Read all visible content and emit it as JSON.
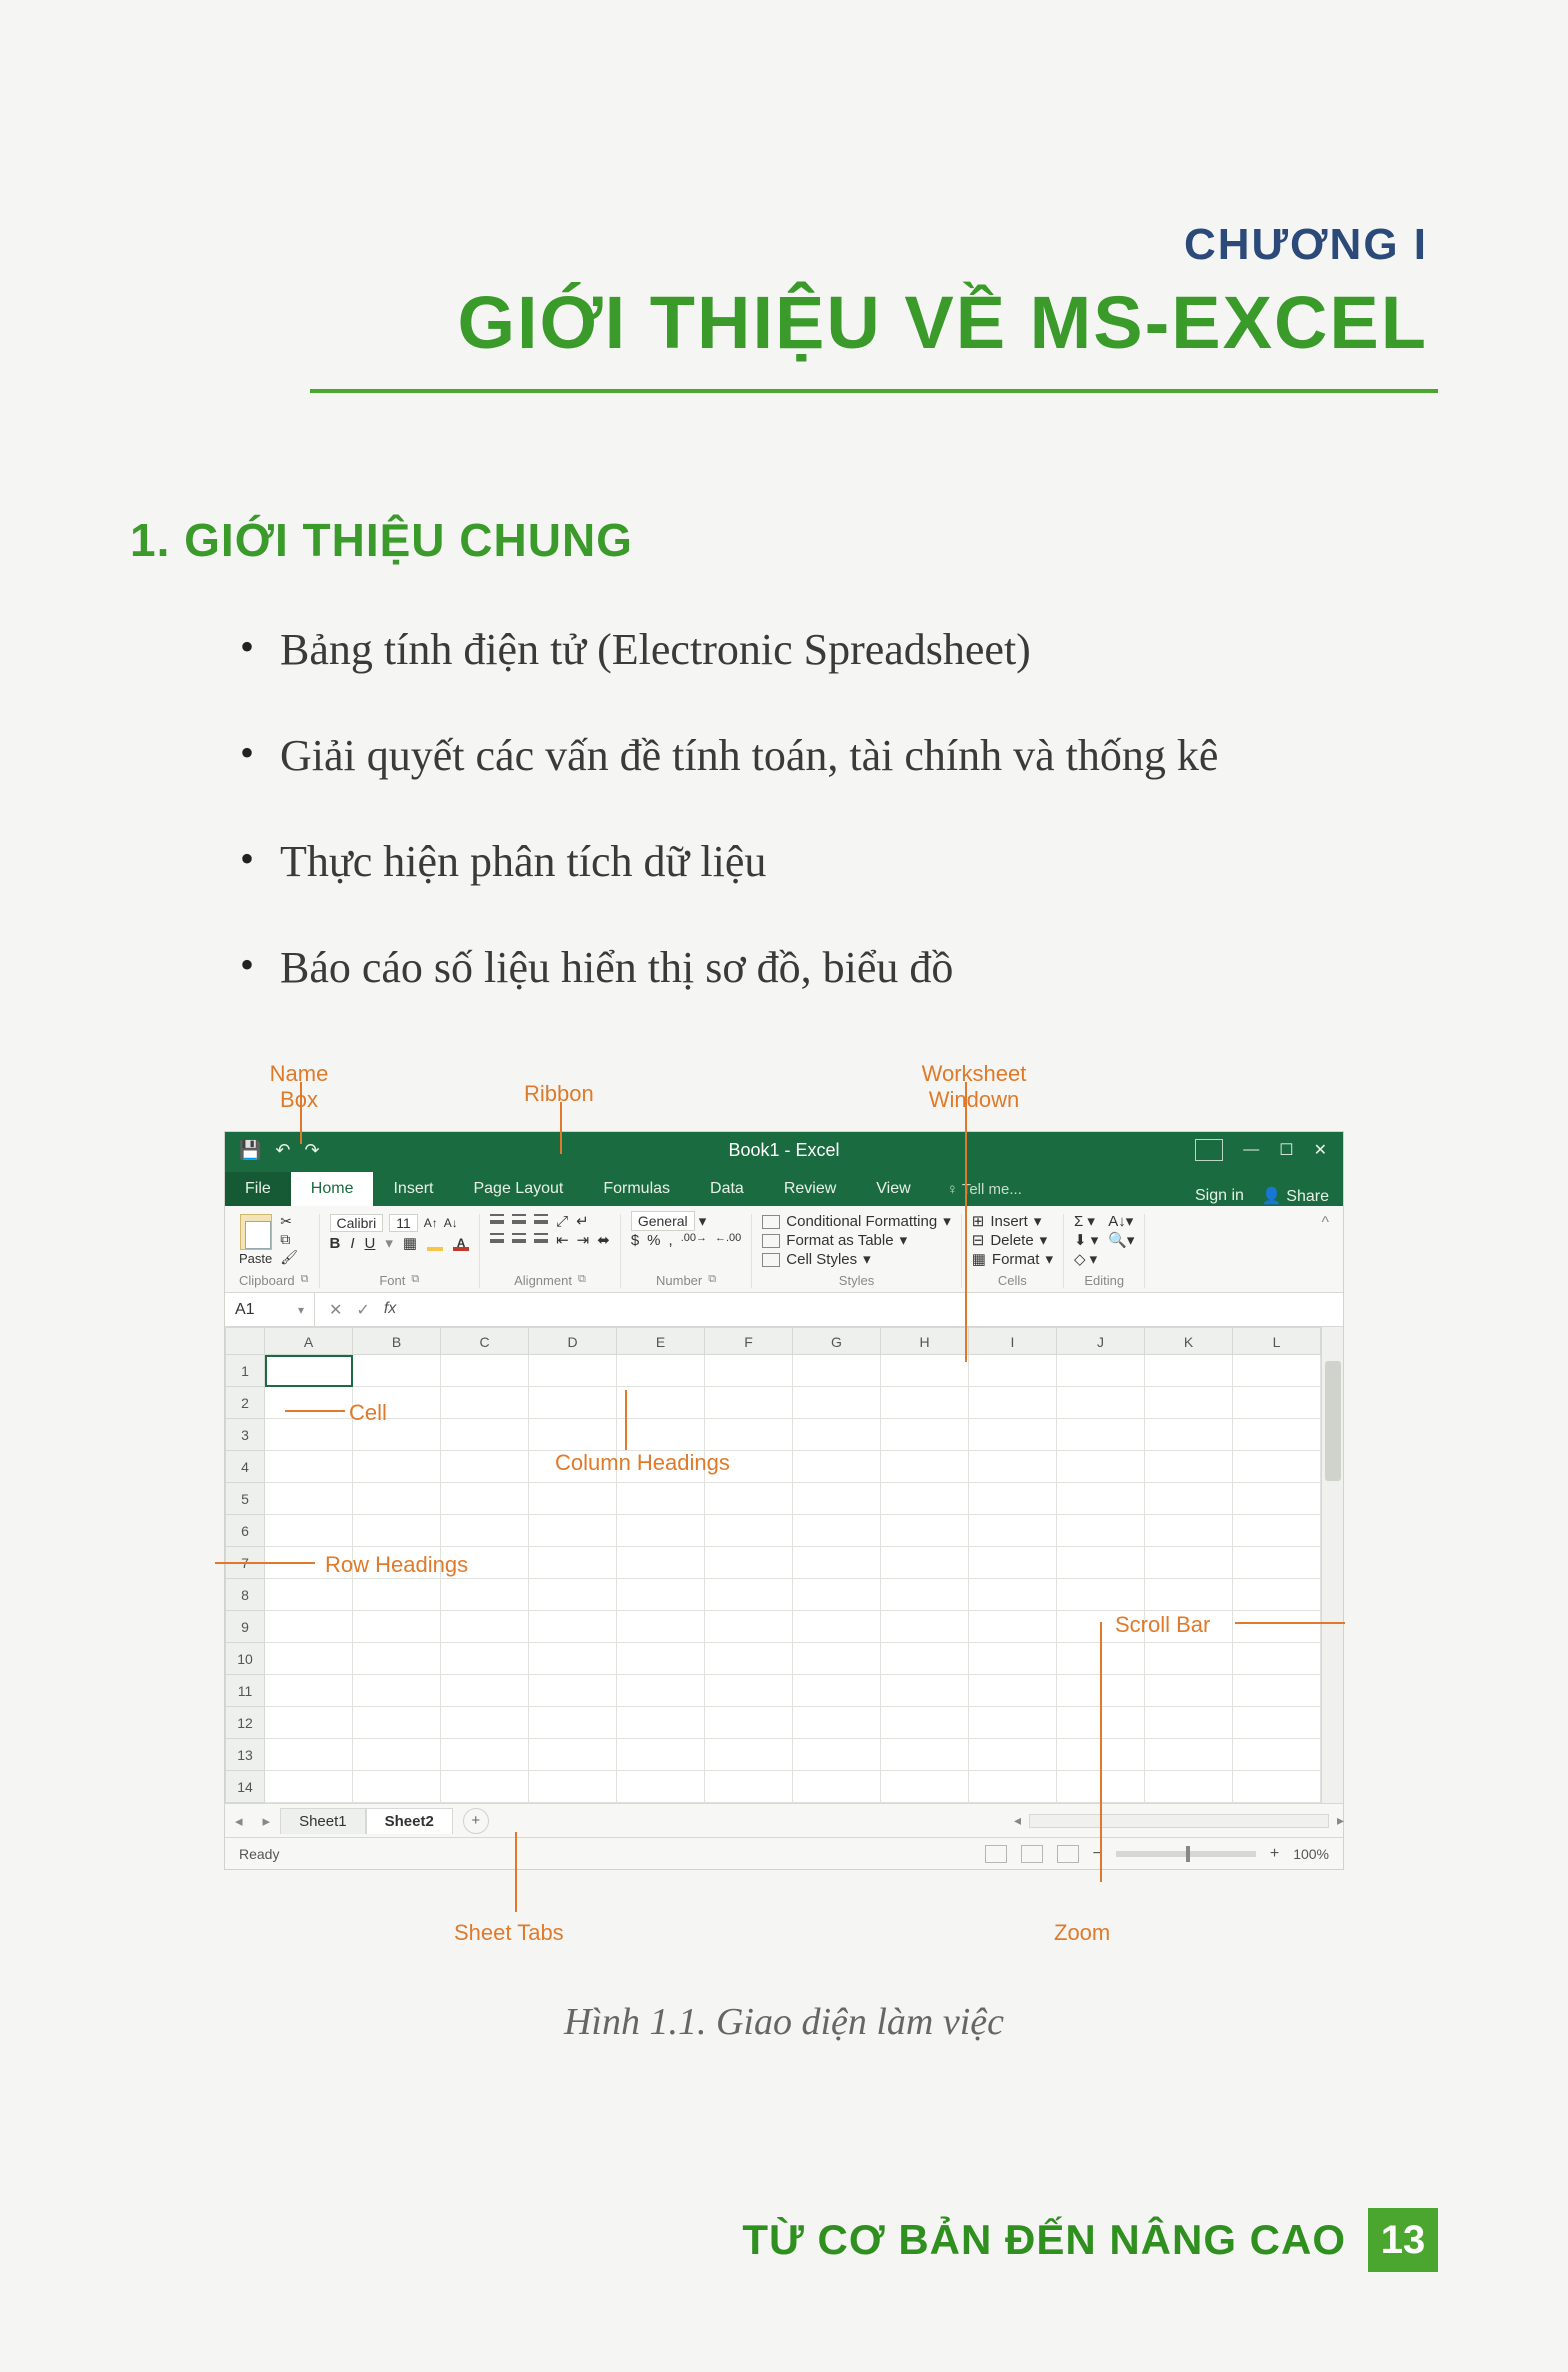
{
  "chapter_label": "CHƯƠNG I",
  "chapter_title": "GIỚI THIỆU VỀ MS-EXCEL",
  "section1_title": "1. GIỚI THIỆU CHUNG",
  "bullets": [
    "Bảng tính điện tử (Electronic Spreadsheet)",
    "Giải quyết các vấn đề tính toán, tài chính và thống kê",
    "Thực hiện phân tích dữ liệu",
    "Báo cáo số liệu hiển thị sơ đồ, biểu đồ"
  ],
  "callouts": {
    "name_box": "Name\nBox",
    "ribbon": "Ribbon",
    "worksheet_window": "Worksheet\nWindown",
    "cell": "Cell",
    "column_headings": "Column Headings",
    "row_headings": "Row Headings",
    "scroll_bar": "Scroll Bar",
    "sheet_tabs": "Sheet Tabs",
    "zoom": "Zoom"
  },
  "excel": {
    "title": "Book1 - Excel",
    "signin": "Sign in",
    "share": "Share",
    "tabs": {
      "file": "File",
      "home": "Home",
      "insert": "Insert",
      "page_layout": "Page Layout",
      "formulas": "Formulas",
      "data": "Data",
      "review": "Review",
      "view": "View",
      "tell_me": "Tell me..."
    },
    "ribbon": {
      "clipboard": {
        "paste": "Paste",
        "name": "Clipboard"
      },
      "font": {
        "family": "Calibri",
        "size": "11",
        "name": "Font"
      },
      "alignment": {
        "name": "Alignment"
      },
      "number": {
        "format": "General",
        "name": "Number"
      },
      "styles": {
        "cond": "Conditional Formatting",
        "table": "Format as Table",
        "cell": "Cell Styles",
        "name": "Styles"
      },
      "cells": {
        "insert": "Insert",
        "delete": "Delete",
        "format": "Format",
        "name": "Cells"
      },
      "editing": {
        "name": "Editing"
      }
    },
    "name_box_value": "A1",
    "columns": [
      "A",
      "B",
      "C",
      "D",
      "E",
      "F",
      "G",
      "H",
      "I",
      "J",
      "K",
      "L"
    ],
    "rows": [
      "1",
      "2",
      "3",
      "4",
      "5",
      "6",
      "7",
      "8",
      "9",
      "10",
      "11",
      "12",
      "13",
      "14"
    ],
    "sheets": {
      "s1": "Sheet1",
      "s2": "Sheet2",
      "add": "+"
    },
    "status": {
      "ready": "Ready",
      "zoom": "100%",
      "minus": "−",
      "plus": "+"
    }
  },
  "caption": "Hình 1.1. Giao diện làm việc",
  "footer_text": "TỪ CƠ BẢN ĐẾN NÂNG CAO",
  "page_number": "13"
}
